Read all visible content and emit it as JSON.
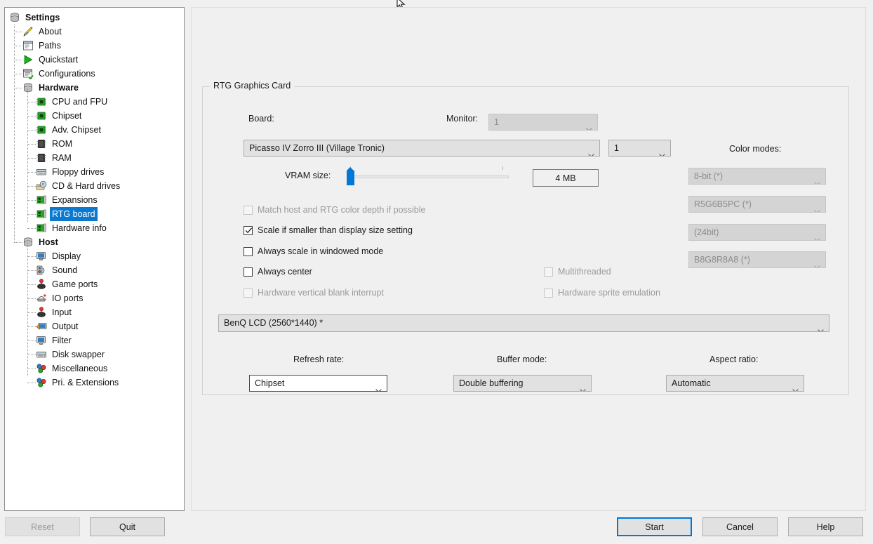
{
  "window": {
    "cursor_icon": "mouse-pointer-icon"
  },
  "sidebar": {
    "items": [
      {
        "label": "Settings",
        "icon": "settings-stack-icon",
        "depth": 0,
        "bold": true,
        "selected": false
      },
      {
        "label": "About",
        "icon": "about-pencil-icon",
        "depth": 1,
        "bold": false,
        "selected": false
      },
      {
        "label": "Paths",
        "icon": "paths-window-icon",
        "depth": 1,
        "bold": false,
        "selected": false
      },
      {
        "label": "Quickstart",
        "icon": "quickstart-play-icon",
        "depth": 1,
        "bold": false,
        "selected": false
      },
      {
        "label": "Configurations",
        "icon": "configurations-list-icon",
        "depth": 1,
        "bold": false,
        "selected": false
      },
      {
        "label": "Hardware",
        "icon": "hardware-stack-icon",
        "depth": 1,
        "bold": true,
        "selected": false
      },
      {
        "label": "CPU and FPU",
        "icon": "chip-green-icon",
        "depth": 2,
        "bold": false,
        "selected": false
      },
      {
        "label": "Chipset",
        "icon": "chip-green-icon",
        "depth": 2,
        "bold": false,
        "selected": false
      },
      {
        "label": "Adv. Chipset",
        "icon": "chip-green-icon",
        "depth": 2,
        "bold": false,
        "selected": false
      },
      {
        "label": "ROM",
        "icon": "rom-chip-icon",
        "depth": 2,
        "bold": false,
        "selected": false
      },
      {
        "label": "RAM",
        "icon": "ram-chip-icon",
        "depth": 2,
        "bold": false,
        "selected": false
      },
      {
        "label": "Floppy drives",
        "icon": "floppy-drive-icon",
        "depth": 2,
        "bold": false,
        "selected": false
      },
      {
        "label": "CD & Hard drives",
        "icon": "cd-harddrive-icon",
        "depth": 2,
        "bold": false,
        "selected": false
      },
      {
        "label": "Expansions",
        "icon": "expansion-card-icon",
        "depth": 2,
        "bold": false,
        "selected": false
      },
      {
        "label": "RTG board",
        "icon": "expansion-card-icon",
        "depth": 2,
        "bold": false,
        "selected": true
      },
      {
        "label": "Hardware info",
        "icon": "expansion-card-icon",
        "depth": 2,
        "bold": false,
        "selected": false
      },
      {
        "label": "Host",
        "icon": "host-stack-icon",
        "depth": 1,
        "bold": true,
        "selected": false
      },
      {
        "label": "Display",
        "icon": "display-monitor-icon",
        "depth": 2,
        "bold": false,
        "selected": false
      },
      {
        "label": "Sound",
        "icon": "sound-speaker-icon",
        "depth": 2,
        "bold": false,
        "selected": false
      },
      {
        "label": "Game ports",
        "icon": "gamepad-icon",
        "depth": 2,
        "bold": false,
        "selected": false
      },
      {
        "label": "IO ports",
        "icon": "io-ports-icon",
        "depth": 2,
        "bold": false,
        "selected": false
      },
      {
        "label": "Input",
        "icon": "input-joystick-icon",
        "depth": 2,
        "bold": false,
        "selected": false
      },
      {
        "label": "Output",
        "icon": "output-monitor-icon",
        "depth": 2,
        "bold": false,
        "selected": false
      },
      {
        "label": "Filter",
        "icon": "filter-monitor-icon",
        "depth": 2,
        "bold": false,
        "selected": false
      },
      {
        "label": "Disk swapper",
        "icon": "disk-swapper-icon",
        "depth": 2,
        "bold": false,
        "selected": false
      },
      {
        "label": "Miscellaneous",
        "icon": "misc-blocks-icon",
        "depth": 2,
        "bold": false,
        "selected": false
      },
      {
        "label": "Pri. & Extensions",
        "icon": "misc-blocks-icon",
        "depth": 2,
        "bold": false,
        "selected": false
      }
    ]
  },
  "main": {
    "group_title": "RTG Graphics Card",
    "board_label": "Board:",
    "board_value": "Picasso IV Zorro III (Village Tronic)",
    "board_index_value": "1",
    "monitor_label": "Monitor:",
    "monitor_value": "1",
    "vram_label": "VRAM size:",
    "vram_value": "4 MB",
    "vram_slider": {
      "min": 0,
      "max": 100,
      "value": 2,
      "ticks": [
        2,
        96
      ]
    },
    "color_modes_label": "Color modes:",
    "color_modes": [
      {
        "value": "8-bit (*)",
        "disabled": true
      },
      {
        "value": "R5G6B5PC (*)",
        "disabled": true
      },
      {
        "value": "(24bit)",
        "disabled": true
      },
      {
        "value": "B8G8R8A8 (*)",
        "disabled": true
      }
    ],
    "checkboxes_left": [
      {
        "label": "Match host and RTG color depth if possible",
        "checked": false,
        "disabled": true
      },
      {
        "label": "Scale if smaller than display size setting",
        "checked": true,
        "disabled": false
      },
      {
        "label": "Always scale in windowed mode",
        "checked": false,
        "disabled": false
      },
      {
        "label": "Always center",
        "checked": false,
        "disabled": false
      },
      {
        "label": "Hardware vertical blank interrupt",
        "checked": false,
        "disabled": true
      }
    ],
    "checkboxes_right": [
      {
        "label": "Multithreaded",
        "checked": false,
        "disabled": true
      },
      {
        "label": "Hardware sprite emulation",
        "checked": false,
        "disabled": true
      }
    ],
    "display_mode_value": "BenQ LCD (2560*1440) *",
    "refresh_rate_label": "Refresh rate:",
    "refresh_rate_value": "Chipset",
    "buffer_mode_label": "Buffer mode:",
    "buffer_mode_value": "Double buffering",
    "aspect_ratio_label": "Aspect ratio:",
    "aspect_ratio_value": "Automatic"
  },
  "footer": {
    "reset_label": "Reset",
    "quit_label": "Quit",
    "start_label": "Start",
    "cancel_label": "Cancel",
    "help_label": "Help"
  },
  "colors": {
    "accent": "#0078d7",
    "selection": "#0b79d0",
    "panel_bg": "#f0f0f0",
    "field_bg": "#e1e1e1",
    "disabled_bg": "#d4d4d4",
    "disabled_text": "#8d8d8d"
  }
}
